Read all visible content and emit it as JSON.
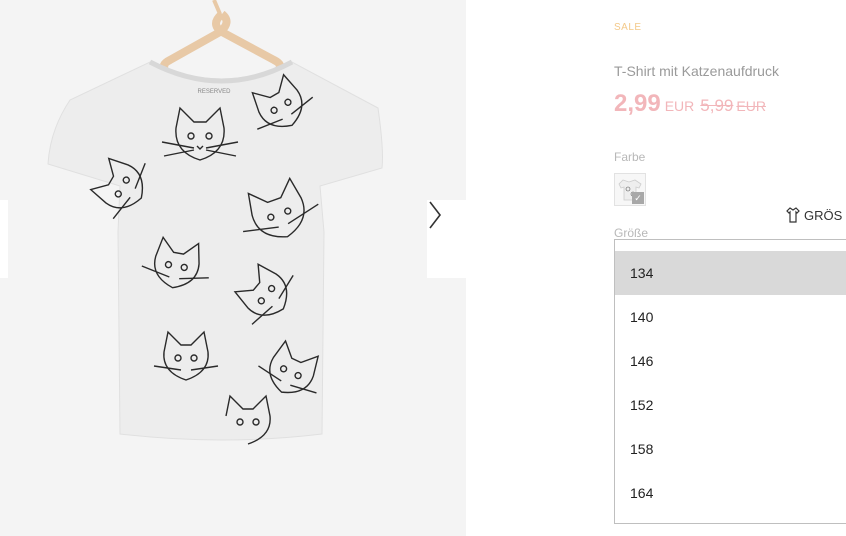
{
  "gallery": {
    "image_alt": "Grey cat print t-shirt on a hanger",
    "label_text": "RESERVED",
    "next_icon": "chevron-right-icon",
    "prev_icon": "chevron-left-icon"
  },
  "product": {
    "badge": "SALE",
    "name": "T-Shirt mit Katzenaufdruck",
    "price_current": "2,99",
    "price_currency": "EUR",
    "price_old": "5,99",
    "price_old_currency": "EUR"
  },
  "color": {
    "label": "Farbe",
    "swatch_check": "✓"
  },
  "size": {
    "label": "Größe",
    "guide_label": "GRÖS",
    "guide_icon": "shirt-icon",
    "options": [
      "134",
      "140",
      "146",
      "152",
      "158",
      "164"
    ],
    "selected": "134"
  },
  "colors": {
    "accent_price": "#f2b6ba",
    "sale_tag": "#f3c98a",
    "selected_option_bg": "#d9d9d9"
  }
}
